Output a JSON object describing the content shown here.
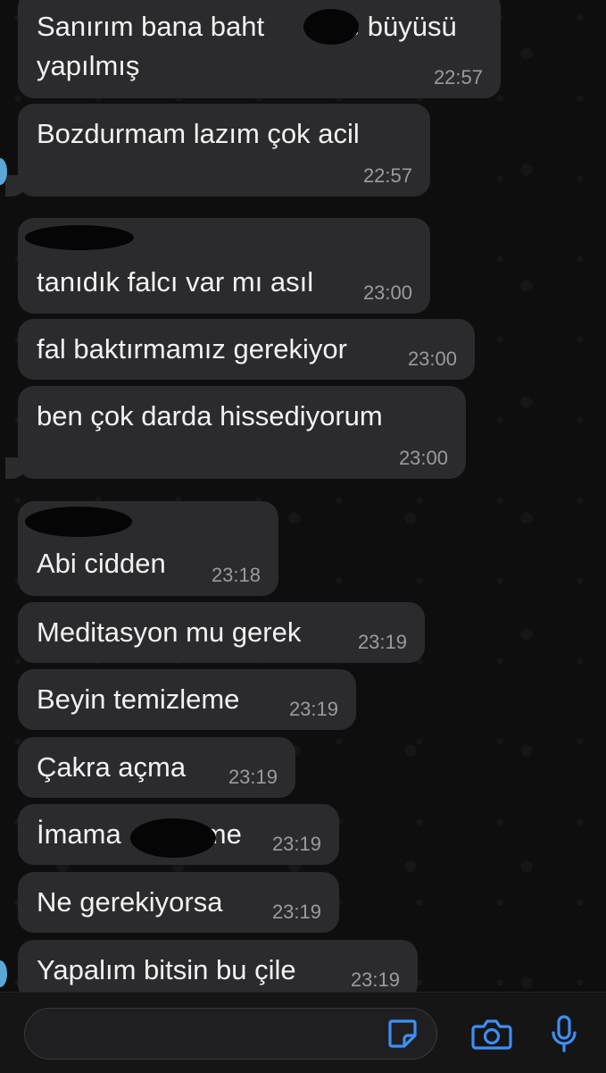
{
  "messages": [
    {
      "lines": [
        "Sanırım bana baht",
        "yapılmış"
      ],
      "line1_suffix": "me büyüsü",
      "time": "22:57"
    },
    {
      "text": "Bozdurmam lazım çok acil",
      "time": "22:57"
    },
    {
      "text": "tanıdık falcı var mı asıl",
      "time": "23:00"
    },
    {
      "text": "fal baktırmamız gerekiyor",
      "time": "23:00"
    },
    {
      "text": "ben çok darda hissediyorum",
      "time": "23:00"
    },
    {
      "text": "Abi cidden",
      "time": "23:18"
    },
    {
      "text": "Meditasyon mu gerek",
      "time": "23:19"
    },
    {
      "text": "Beyin temizleme",
      "time": "23:19"
    },
    {
      "text": "Çakra açma",
      "time": "23:19"
    },
    {
      "text_prefix": "İmama",
      "text_suffix": "me",
      "time": "23:19"
    },
    {
      "text": "Ne gerekiyorsa",
      "time": "23:19"
    },
    {
      "text": "Yapalım bitsin bu çile",
      "time": "23:19"
    }
  ],
  "colors": {
    "bubble": "#2b2b2d",
    "background": "#0e0e0e",
    "accent": "#3d8ff5",
    "timestamp": "#9b9b9f"
  },
  "input_bar": {
    "icons": [
      "sticker-icon",
      "camera-icon",
      "microphone-icon"
    ]
  }
}
